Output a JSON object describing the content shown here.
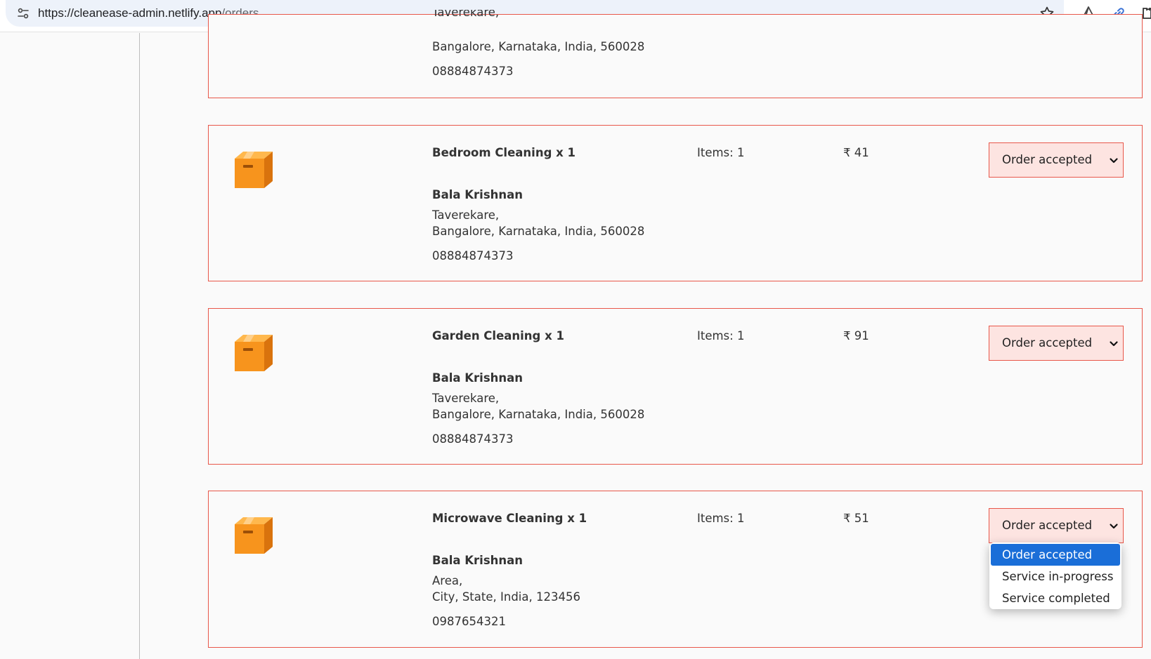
{
  "browser": {
    "url_host": "https://cleanease-admin.netlify.app",
    "url_path": "/orders"
  },
  "orders": [
    {
      "service": "",
      "items": "",
      "price": "",
      "customer": "",
      "address_line1": "Taverekare,",
      "address_line2": "Bangalore, Karnataka, India, 560028",
      "phone": "08884874373",
      "status": ""
    },
    {
      "service": "Bedroom Cleaning x 1",
      "items": "Items: 1",
      "price": "₹ 41",
      "customer": "Bala Krishnan",
      "address_line1": "Taverekare,",
      "address_line2": "Bangalore, Karnataka, India, 560028",
      "phone": "08884874373",
      "status": "Order accepted"
    },
    {
      "service": "Garden Cleaning x 1",
      "items": "Items: 1",
      "price": "₹ 91",
      "customer": "Bala Krishnan",
      "address_line1": "Taverekare,",
      "address_line2": "Bangalore, Karnataka, India, 560028",
      "phone": "08884874373",
      "status": "Order accepted"
    },
    {
      "service": "Microwave Cleaning x 1",
      "items": "Items: 1",
      "price": "₹ 51",
      "customer": "Bala Krishnan",
      "address_line1": "Area,",
      "address_line2": "City, State, India, 123456",
      "phone": "0987654321",
      "status": "Order accepted"
    }
  ],
  "status_options": [
    "Order accepted",
    "Service in-progress",
    "Service completed"
  ],
  "colors": {
    "card_border": "#e8574a",
    "select_bg": "#fde4e1",
    "option_selected_bg": "#1a6ed8",
    "box_icon": "#f7941d"
  }
}
